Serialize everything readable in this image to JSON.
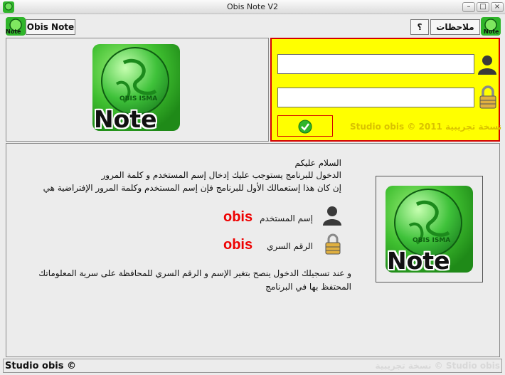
{
  "window": {
    "title": "Obis Note V2",
    "minimize": "–",
    "maximize": "□",
    "close": "×"
  },
  "toolbar": {
    "app_button_label": "Obis Note",
    "help_button_label": "؟",
    "notes_button_label": "ملاحظات"
  },
  "icon_caption": "Note",
  "logo": {
    "caption": "Note",
    "ring_text": "OBIS ISMA"
  },
  "login": {
    "username_value": "",
    "password_value": "",
    "submit_icon": "check-icon",
    "footer_text": "Studio obis © 2011 نسخة تجريبية"
  },
  "info": {
    "line1": "السلام عليكم",
    "line2": "الدخول للبرنامج يستوجب عليك إدخال إسم المستخدم و كلمة المرور",
    "line3": "إن كان هذا إستعمالك الأول للبرنامج فإن إسم المستخدم وكلمة المرور الإفتراضية هي",
    "username_label": "إسم المستخدم",
    "username_value": "obis",
    "password_label": "الرقم السري",
    "password_value": "obis",
    "advice_line1": "و عند تسجيلك الدخول ينصح بتغير الإسم و الرقم السري للمحافظة على سرية المعلوماتك",
    "advice_line2": "المحتفظ بها في البرنامج"
  },
  "statusbar": {
    "left": "Studio obis ©",
    "right": "نسخة تجريبية © Studio obis"
  },
  "colors": {
    "login_panel": "#ffff00",
    "login_border": "#d40000",
    "accent_green": "#2fb52a",
    "obis_red": "#e00000"
  }
}
